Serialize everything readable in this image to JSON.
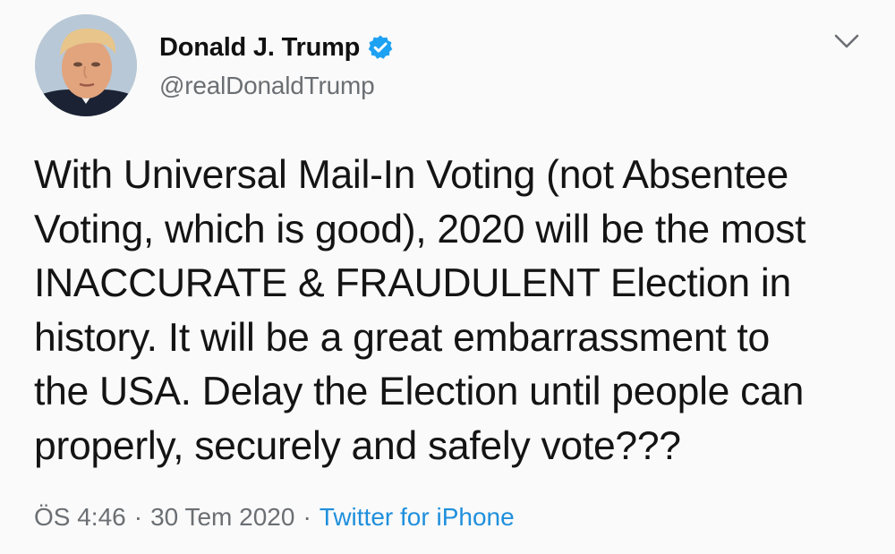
{
  "author": {
    "display_name": "Donald J. Trump",
    "handle": "@realDonaldTrump",
    "verified": true,
    "verified_icon": "verified-badge-icon",
    "verified_color": "#1da1f2"
  },
  "menu": {
    "icon": "chevron-down-icon"
  },
  "tweet": {
    "text": "With Universal Mail-In Voting (not Absentee\nVoting, which is good), 2020 will be the most\nINACCURATE & FRAUDULENT Election in\nhistory. It will be a great embarrassment to\nthe USA. Delay the Election until people can\nproperly, securely and safely vote???"
  },
  "meta": {
    "time": "ÖS 4:46",
    "separator": "·",
    "date": "30 Tem 2020",
    "source": "Twitter for iPhone",
    "source_color": "#1f8fdc"
  }
}
